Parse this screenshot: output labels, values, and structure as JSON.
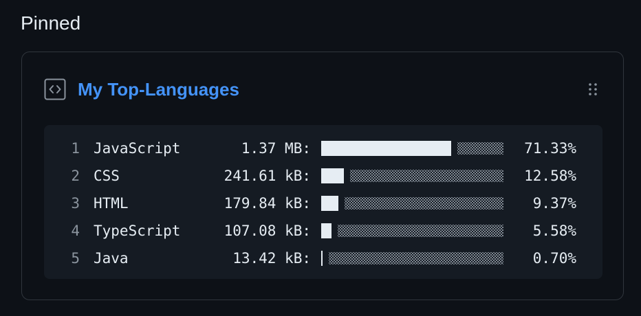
{
  "section": {
    "title": "Pinned"
  },
  "card": {
    "icon": "code-square-icon",
    "title": "My Top-Languages",
    "drag_icon": "grabber-icon"
  },
  "languages": [
    {
      "rank": "1",
      "name": "JavaScript",
      "size": "1.37 MB:",
      "percent": "71.33%",
      "value": 71.33
    },
    {
      "rank": "2",
      "name": "CSS",
      "size": "241.61 kB:",
      "percent": "12.58%",
      "value": 12.58
    },
    {
      "rank": "3",
      "name": "HTML",
      "size": "179.84 kB:",
      "percent": "9.37%",
      "value": 9.37
    },
    {
      "rank": "4",
      "name": "TypeScript",
      "size": "107.08 kB:",
      "percent": "5.58%",
      "value": 5.58
    },
    {
      "rank": "5",
      "name": "Java",
      "size": "13.42 kB:",
      "percent": "0.70%",
      "value": 0.7
    }
  ],
  "colors": {
    "background": "#0d1117",
    "border": "#30363d",
    "link": "#4493f8",
    "code_bg": "#151b23",
    "bar_fill": "#e6edf3",
    "muted": "#8b949e"
  }
}
